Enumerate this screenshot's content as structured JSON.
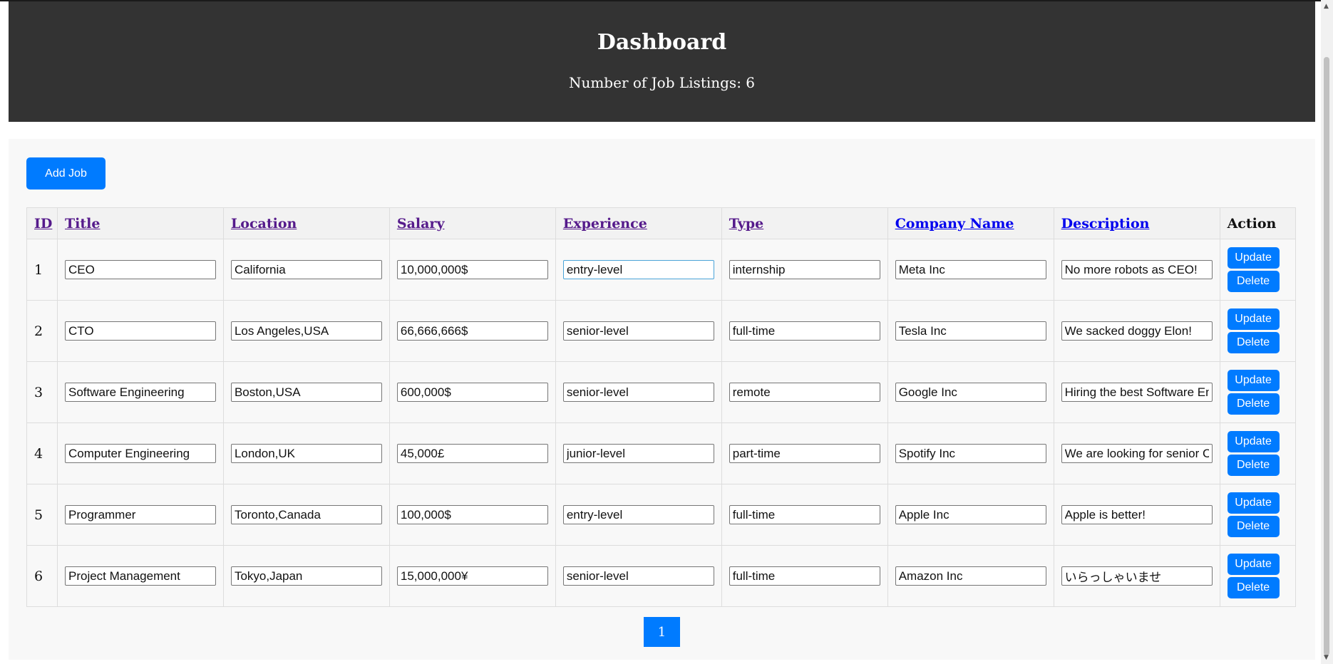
{
  "header": {
    "title": "Dashboard",
    "count_label": "Number of Job Listings: 6"
  },
  "toolbar": {
    "add_job_label": "Add Job"
  },
  "table": {
    "columns": [
      "ID",
      "Title",
      "Location",
      "Salary",
      "Experience",
      "Type",
      "Company Name",
      "Description",
      "Action"
    ],
    "rows": [
      {
        "id": "1",
        "title": "CEO",
        "location": "California",
        "salary": "10,000,000$",
        "experience": "entry-level",
        "type": "internship",
        "company": "Meta Inc",
        "description": "No more robots as CEO!"
      },
      {
        "id": "2",
        "title": "CTO",
        "location": "Los Angeles,USA",
        "salary": "66,666,666$",
        "experience": "senior-level",
        "type": "full-time",
        "company": "Tesla Inc",
        "description": "We sacked doggy Elon!"
      },
      {
        "id": "3",
        "title": "Software Engineering",
        "location": "Boston,USA",
        "salary": "600,000$",
        "experience": "senior-level",
        "type": "remote",
        "company": "Google Inc",
        "description": "Hiring the best Software En"
      },
      {
        "id": "4",
        "title": "Computer Engineering",
        "location": "London,UK",
        "salary": "45,000£",
        "experience": "junior-level",
        "type": "part-time",
        "company": "Spotify Inc",
        "description": "We are looking for senior Co"
      },
      {
        "id": "5",
        "title": "Programmer",
        "location": "Toronto,Canada",
        "salary": "100,000$",
        "experience": "entry-level",
        "type": "full-time",
        "company": "Apple Inc",
        "description": "Apple is better!"
      },
      {
        "id": "6",
        "title": "Project Management",
        "location": "Tokyo,Japan",
        "salary": "15,000,000¥",
        "experience": "senior-level",
        "type": "full-time",
        "company": "Amazon Inc",
        "description": "いらっしゃいませ"
      }
    ],
    "update_label": "Update",
    "delete_label": "Delete"
  },
  "pagination": {
    "current_page": "1"
  },
  "colors": {
    "header_bg": "#333333",
    "accent": "#007bff",
    "visited_link": "#551a8b",
    "link": "#0000ee"
  }
}
